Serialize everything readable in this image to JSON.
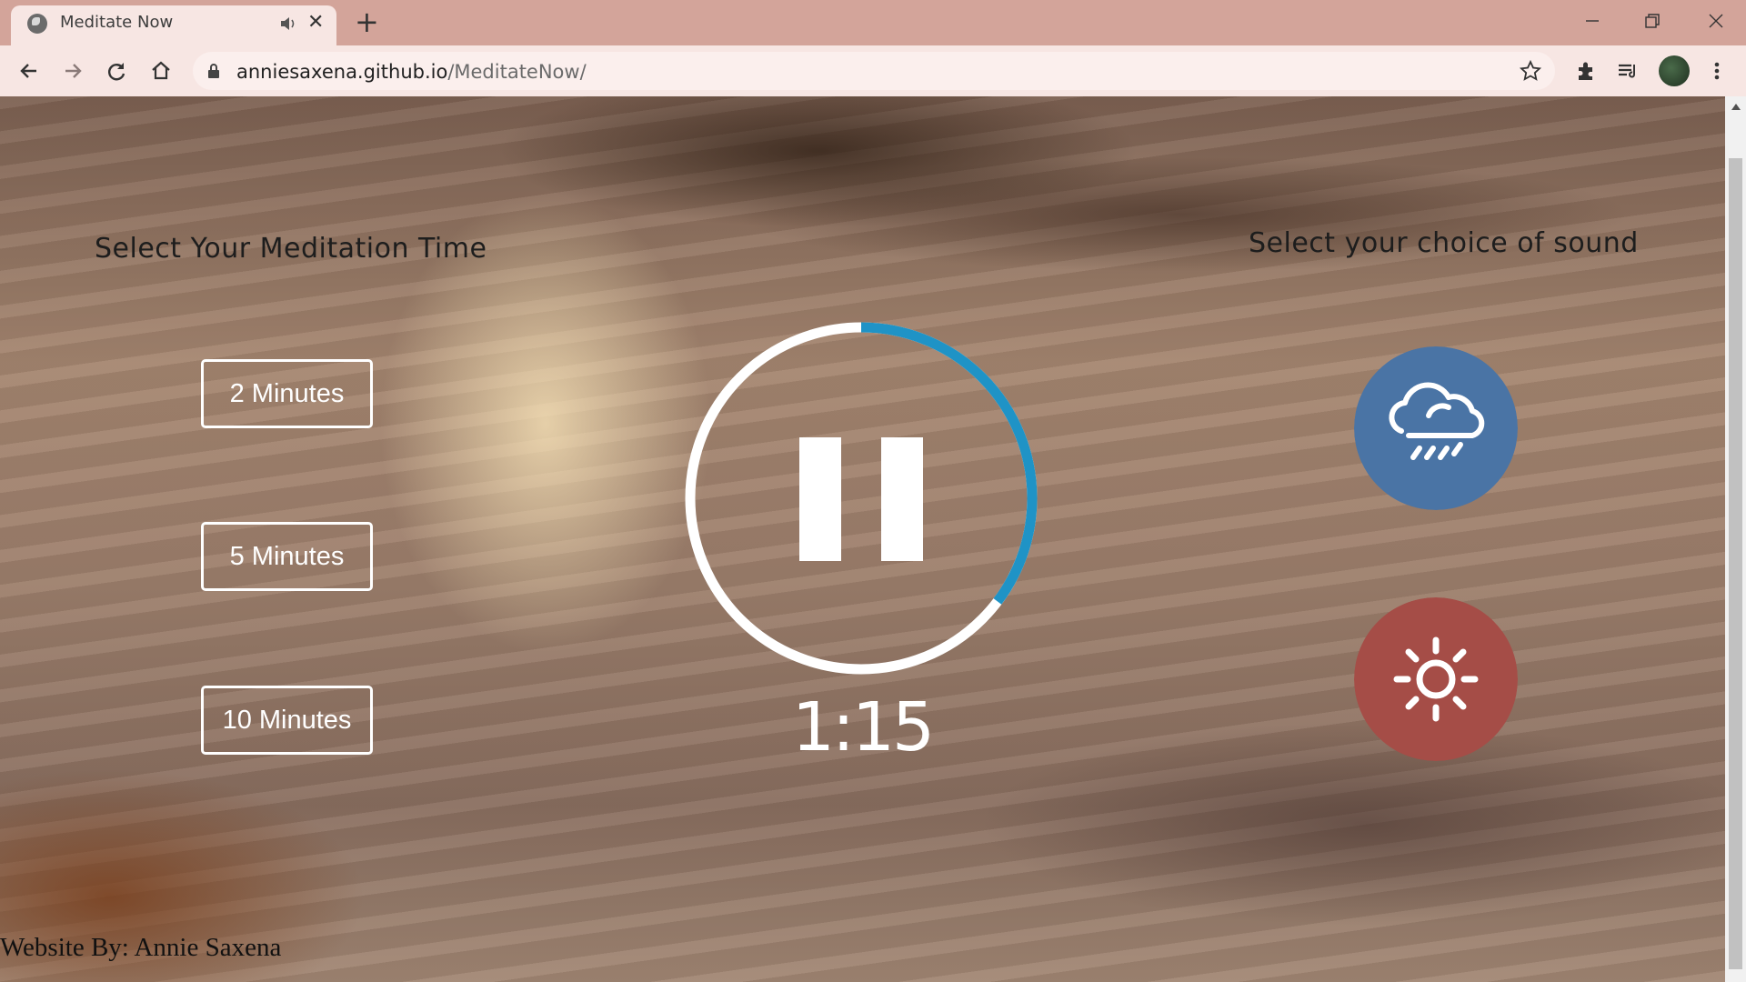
{
  "browser": {
    "tab_title": "Meditate Now",
    "url_host": "anniesaxena.github.io",
    "url_path": "/MeditateNow/"
  },
  "page": {
    "time_heading": "Select Your Meditation Time",
    "sound_heading": "Select your choice of sound",
    "time_buttons": [
      "2 Minutes",
      "5 Minutes",
      "10 Minutes"
    ],
    "timer": "1:15",
    "player_state": "playing",
    "footer": "Website By: Annie Saxena"
  },
  "icons": {
    "play_pause": "pause-icon",
    "sound_1": "rain-cloud-icon",
    "sound_2": "sun-icon"
  },
  "colors": {
    "progress": "#1f93c6",
    "track": "#ffffff",
    "rain_button": "#4a74a5",
    "sun_button": "#a54d47"
  }
}
